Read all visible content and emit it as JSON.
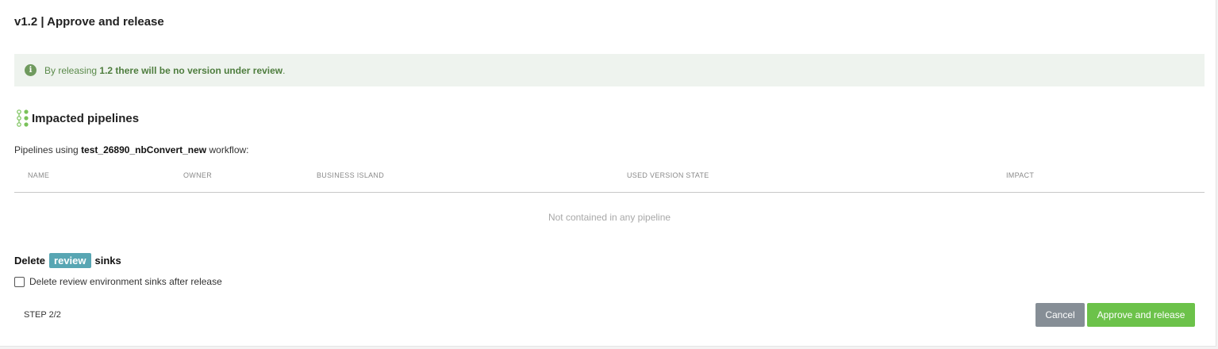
{
  "dialog": {
    "title": "v1.2 | Approve and release"
  },
  "notice": {
    "icon": "info-icon",
    "text_prefix": "By releasing",
    "text_bold": "1.2 there will be no version under review",
    "text_suffix": "."
  },
  "impacted": {
    "icon": "pipeline-icon",
    "title": "Impacted pipelines",
    "pipelines_prefix": "Pipelines using",
    "workflow_name": "test_26890_nbConvert_new",
    "pipelines_suffix": "workflow:",
    "columns": [
      "NAME",
      "OWNER",
      "BUSINESS ISLAND",
      "USED VERSION STATE",
      "IMPACT"
    ],
    "empty_message": "Not contained in any pipeline"
  },
  "delete_sinks": {
    "prefix": "Delete",
    "tag": "review",
    "suffix": "sinks",
    "checkbox_label": "Delete review environment sinks after release",
    "checked": false
  },
  "footer": {
    "step": "STEP 2/2",
    "cancel_label": "Cancel",
    "approve_label": "Approve and release"
  },
  "colors": {
    "notice_bg": "#eef3ee",
    "notice_text": "#5a8a4a",
    "tag_bg": "#58a6b3",
    "cancel_bg": "#868e96",
    "approve_bg": "#6cc24a",
    "pipeline_icon": "#7ac25a"
  }
}
